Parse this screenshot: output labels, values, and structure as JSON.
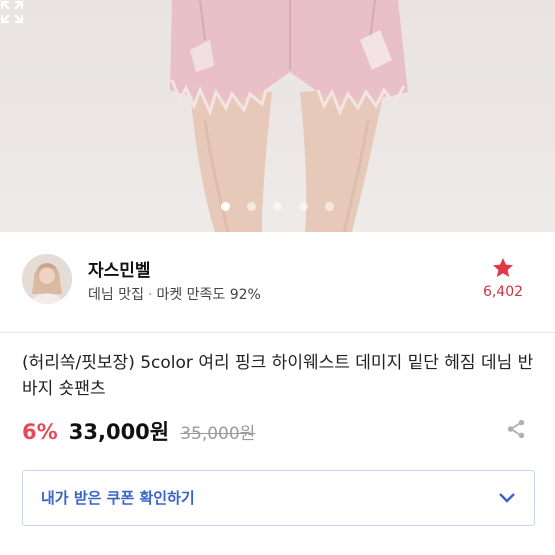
{
  "carousel": {
    "total": 5,
    "active": 0
  },
  "seller": {
    "name": "자스민벨",
    "category": "데님 맛집",
    "satisfaction": "마켓 만족도 92%",
    "favorite_count": "6,402"
  },
  "product": {
    "title": "(허리쏙/핏보장) 5color 여리 핑크 하이웨스트 데미지 밑단 헤짐 데님 반바지 숏팬츠",
    "discount": "6%",
    "price": "33,000원",
    "original_price": "35,000원"
  },
  "coupon": {
    "label": "내가 받은 쿠폰 확인하기"
  },
  "colors": {
    "accent_red": "#e64a5a",
    "link_blue": "#3a63c8",
    "star_red": "#e23744"
  },
  "icons": [
    "expand-icon",
    "star-icon",
    "share-icon",
    "chevron-down-icon"
  ]
}
